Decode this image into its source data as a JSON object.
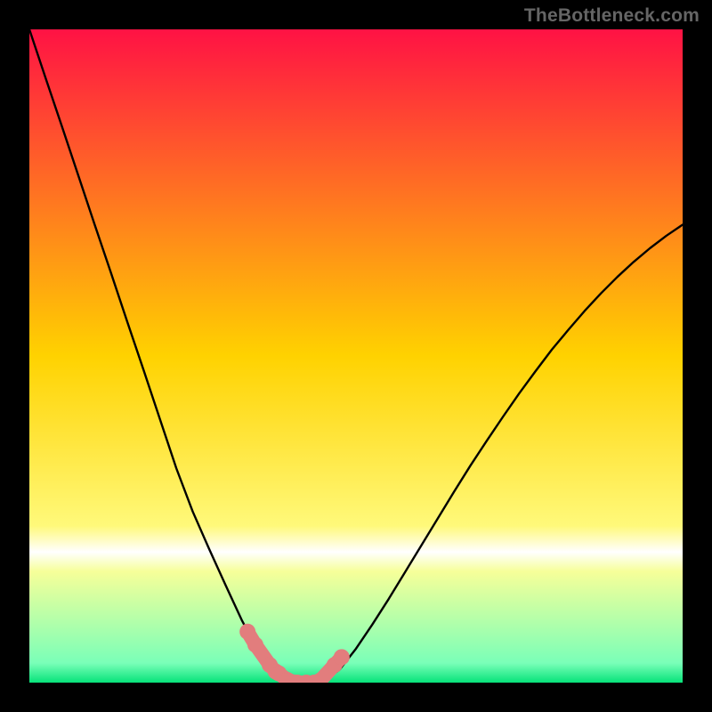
{
  "watermark": "TheBottleneck.com",
  "chart_data": {
    "type": "line",
    "title": "",
    "xlabel": "",
    "ylabel": "",
    "xlim": [
      0,
      100
    ],
    "ylim": [
      0,
      100
    ],
    "grid": false,
    "legend": false,
    "background_gradient": {
      "stops": [
        {
          "offset": 0.0,
          "color": "#ff1244"
        },
        {
          "offset": 0.5,
          "color": "#ffd200"
        },
        {
          "offset": 0.76,
          "color": "#fff97a"
        },
        {
          "offset": 0.8,
          "color": "#ffffff"
        },
        {
          "offset": 0.83,
          "color": "#f6ff99"
        },
        {
          "offset": 0.97,
          "color": "#7affb8"
        },
        {
          "offset": 1.0,
          "color": "#07e37a"
        }
      ]
    },
    "series": [
      {
        "name": "curve",
        "stroke": "#000000",
        "x": [
          0.0,
          2.5,
          5.0,
          7.5,
          10.0,
          12.5,
          15.0,
          17.5,
          20.0,
          22.5,
          25.0,
          27.5,
          30.0,
          32.5,
          33.5,
          35.0,
          37.5,
          40.0,
          42.5,
          44.0,
          45.0,
          47.5,
          50.0,
          52.5,
          55.0,
          57.5,
          60.0,
          62.5,
          65.0,
          67.5,
          70.0,
          72.5,
          75.0,
          77.5,
          80.0,
          82.5,
          85.0,
          87.5,
          90.0,
          92.5,
          95.0,
          97.5,
          100.0
        ],
        "values": [
          100.0,
          92.5,
          85.1,
          77.6,
          70.1,
          62.7,
          55.2,
          47.8,
          40.3,
          32.8,
          26.2,
          20.5,
          15.0,
          9.6,
          7.7,
          5.4,
          2.2,
          0.4,
          0.0,
          0.0,
          0.2,
          2.0,
          5.2,
          8.9,
          12.8,
          16.9,
          21.0,
          25.1,
          29.2,
          33.2,
          37.0,
          40.7,
          44.3,
          47.7,
          51.0,
          54.0,
          56.9,
          59.6,
          62.1,
          64.4,
          66.5,
          68.4,
          70.1
        ]
      },
      {
        "name": "trough-markers",
        "stroke": "#e27d7d",
        "style": "thick-dots",
        "x": [
          33.4,
          34.6,
          36.8,
          37.7,
          38.2,
          39.5,
          41.0,
          42.4,
          43.6,
          44.5,
          46.7,
          47.8
        ],
        "values": [
          7.8,
          5.8,
          2.7,
          1.7,
          1.4,
          0.4,
          0.0,
          0.0,
          0.0,
          0.3,
          2.7,
          3.9
        ]
      }
    ]
  }
}
